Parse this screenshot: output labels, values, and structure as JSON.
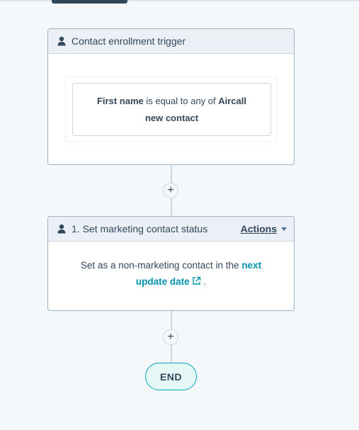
{
  "trigger": {
    "header_title": "Contact enrollment trigger",
    "criteria_field": "First name",
    "criteria_operator": " is equal to any of ",
    "criteria_value_part1": "Aircall",
    "criteria_value_part2": "new contact"
  },
  "connectors": {
    "add_step_symbol": "+"
  },
  "action": {
    "header_title": "1. Set marketing contact status",
    "actions_label": "Actions",
    "body_text": "Set as a non-marketing contact in the ",
    "body_link_part1": "next",
    "body_link_part2": "update date",
    "body_end": "."
  },
  "end": {
    "label": "END"
  },
  "icons": {
    "person": "person-icon",
    "caret": "caret-down-icon",
    "external_link": "external-link-icon"
  },
  "colors": {
    "link": "#0091ae",
    "end_border": "#00a4bd",
    "end_fill": "#e5f8f6"
  }
}
